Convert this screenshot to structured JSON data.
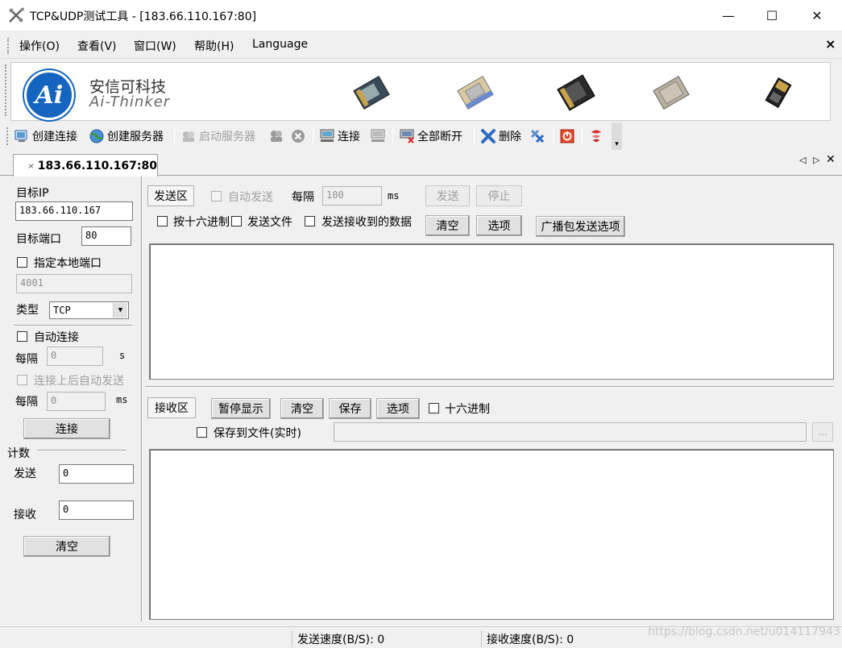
{
  "window": {
    "title": "TCP&UDP测试工具 - [183.66.110.167:80]",
    "minimize_glyph": "—",
    "maximize_glyph": "☐",
    "close_glyph": "✕"
  },
  "menu": {
    "items": [
      "操作(O)",
      "查看(V)",
      "窗口(W)",
      "帮助(H)",
      "Language"
    ],
    "close_glyph": "×"
  },
  "banner": {
    "logo_text": "Ai",
    "brand_cn": "安信可科技",
    "brand_en": "Ai-Thinker"
  },
  "toolbar": {
    "create_connection": "创建连接",
    "create_server": "创建服务器",
    "start_server": "启动服务器",
    "connect": "连接",
    "disconnect_all": "全部断开",
    "delete": "删除"
  },
  "tab": {
    "label": "183.66.110.167:80",
    "nav_prev": "◁",
    "nav_next": "▷",
    "close": "✕"
  },
  "left": {
    "target_ip_label": "目标IP",
    "target_ip_value": "183.66.110.167",
    "target_port_label": "目标端口",
    "target_port_value": "80",
    "local_port_check_label": "指定本地端口",
    "local_port_value": "4001",
    "type_label": "类型",
    "type_value": "TCP",
    "auto_connect_label": "自动连接",
    "interval_label": "每隔",
    "interval_value": "0",
    "interval_unit_s": "s",
    "auto_send_after_connect_label": "连接上后自动发送",
    "interval2_label": "每隔",
    "interval2_value": "0",
    "interval2_unit": "ms",
    "connect_button": "连接",
    "count_title": "计数",
    "send_label": "发送",
    "send_count": "0",
    "recv_label": "接收",
    "recv_count": "0",
    "clear_button": "清空"
  },
  "send": {
    "area_label": "发送区",
    "auto_send_label": "自动发送",
    "interval_label": "每隔",
    "interval_value": "100",
    "unit": "ms",
    "send_button": "发送",
    "stop_button": "停止",
    "hex_label": "按十六进制",
    "send_file_label": "发送文件",
    "send_received_label": "发送接收到的数据",
    "clear_button": "清空",
    "options_button": "选项",
    "broadcast_button": "广播包发送选项"
  },
  "receive": {
    "area_label": "接收区",
    "pause_button": "暂停显示",
    "clear_button": "清空",
    "save_button": "保存",
    "options_button": "选项",
    "hex_label": "十六进制",
    "save_to_file_label": "保存到文件(实时)",
    "browse_button": "..."
  },
  "status": {
    "send_speed": "发送速度(B/S): 0",
    "recv_speed": "接收速度(B/S): 0",
    "watermark": "https://blog.csdn.net/u014117943"
  }
}
